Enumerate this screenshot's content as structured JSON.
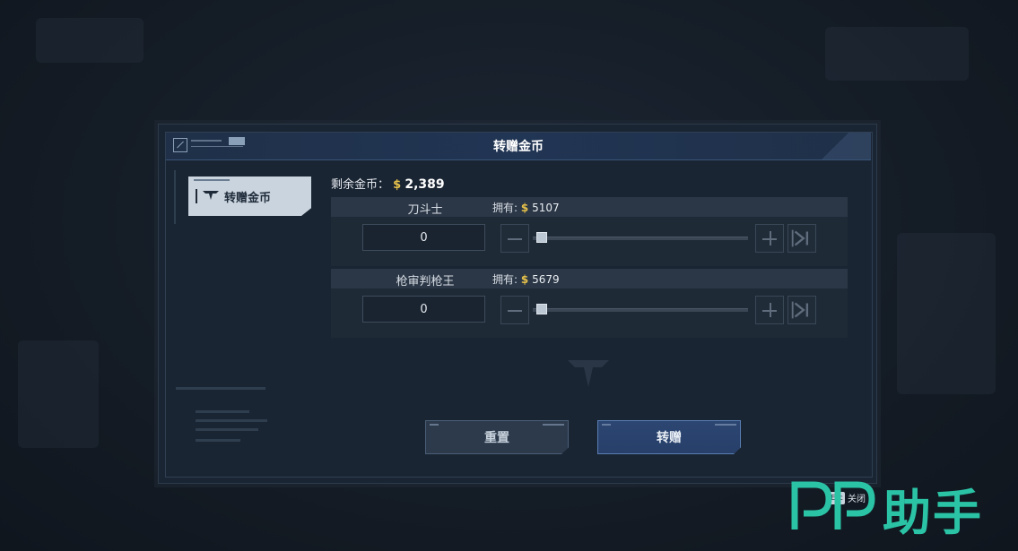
{
  "dialog": {
    "title": "转赠金币"
  },
  "sidebar": {
    "tab_label": "转赠金币"
  },
  "balance": {
    "label": "剩余金币：",
    "currency_symbol": "$",
    "amount": "2,389"
  },
  "transfers": [
    {
      "recipient": "刀斗士",
      "owned_label": "拥有:",
      "currency_symbol": "$",
      "owned_amount": "5107",
      "value": "0",
      "slider_fraction": 0
    },
    {
      "recipient": "枪审判枪王",
      "owned_label": "拥有:",
      "currency_symbol": "$",
      "owned_amount": "5679",
      "value": "0",
      "slider_fraction": 0
    }
  ],
  "buttons": {
    "reset_label": "重置",
    "confirm_label": "转赠"
  },
  "footer": {
    "esc_key": "Esc",
    "close_label": "关闭"
  },
  "watermark": {
    "brand": "PP助手"
  },
  "colors": {
    "coin": "#e6c14a",
    "confirm_button": "#2c4672",
    "watermark": "#2bc3a6"
  }
}
